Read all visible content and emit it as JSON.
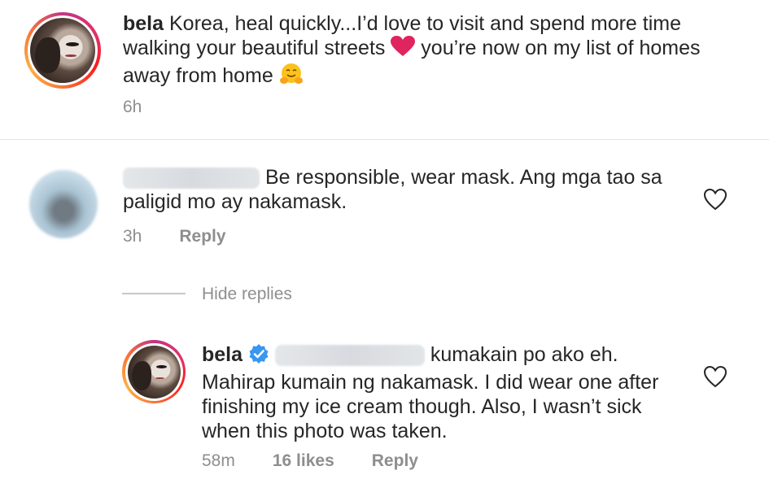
{
  "comments": [
    {
      "username": "bela",
      "text_part1": "Korea, heal quickly...I’d love to visit and spend more time walking your beautiful streets",
      "text_part2": "you’re now on my list of homes away from home",
      "time": "6h"
    },
    {
      "username_redacted": true,
      "text_line1": "Be responsible, wear mask. Ang mga tao sa",
      "text_line2": "paligid mo ay nakamask.",
      "time": "3h",
      "reply_label": "Reply"
    }
  ],
  "hide_replies_label": "Hide replies",
  "reply": {
    "username": "bela",
    "verified": true,
    "text_line1": "kumakain po ako eh.",
    "text_line2": "Mahirap kumain ng nakamask. I did wear one after",
    "text_line3": "finishing my ice cream though. Also, I wasn’t sick",
    "text_line4": "when this photo was taken.",
    "time": "58m",
    "likes": "16 likes",
    "reply_label": "Reply"
  },
  "colors": {
    "text": "#262626",
    "meta": "#8e8e8e",
    "verified": "#3897f0",
    "heart_emoji": "#e0245e"
  },
  "icons": [
    "heart-emoji-icon",
    "hugging-face-emoji-icon",
    "heart-outline-icon",
    "verified-badge-icon"
  ]
}
